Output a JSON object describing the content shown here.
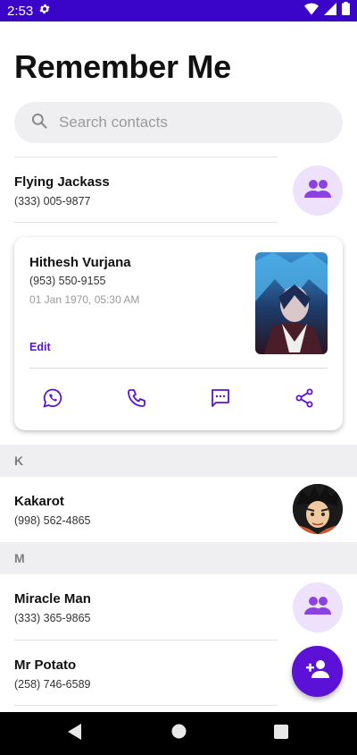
{
  "status_bar": {
    "time": "2:53",
    "color": "#3a05c9"
  },
  "title": "Remember Me",
  "search": {
    "placeholder": "Search contacts",
    "value": ""
  },
  "contacts_top": [
    {
      "name": "Flying Jackass",
      "phone": "(333) 005-9877",
      "avatar": "group-icon"
    }
  ],
  "expanded_card": {
    "name": "Hithesh Vurjana",
    "phone": "(953) 550-9155",
    "date": "01 Jan 1970, 05:30 AM",
    "edit_label": "Edit",
    "actions": [
      "whatsapp-icon",
      "phone-icon",
      "message-icon",
      "share-icon"
    ]
  },
  "sections": [
    {
      "letter": "K",
      "contacts": [
        {
          "name": "Kakarot",
          "phone": "(998) 562-4865",
          "avatar": "photo"
        }
      ]
    },
    {
      "letter": "M",
      "contacts": [
        {
          "name": "Miracle Man",
          "phone": "(333) 365-9865",
          "avatar": "group-icon"
        },
        {
          "name": "Mr Potato",
          "phone": "(258) 746-6589",
          "avatar": "none"
        }
      ]
    }
  ],
  "fab": {
    "icon": "add-person-icon",
    "color": "#5b12d6"
  },
  "accent_color": "#5b12d6",
  "avatar_bg": "#ede1fb"
}
